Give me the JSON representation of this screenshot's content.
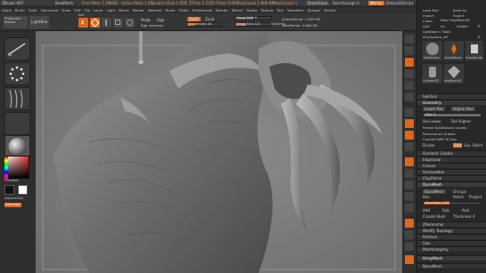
{
  "titlebar": {
    "app": "ZBrush 4R7",
    "items": [
      "ZBrush 4R7",
      "NewMesh",
      "Free Mem 7.398GB",
      "Active Mem 1.05",
      "Scratch Disk 1.059",
      "ZTime 1.2355",
      "Timer 0.005",
      "PolyCount 1.609 KP",
      "MeshCount 1"
    ],
    "right_items": [
      "QuickSave",
      "See-through 0",
      "Menus",
      "DefaultZScript"
    ]
  },
  "menubar": {
    "items": [
      "Alpha",
      "Brush",
      "Color",
      "Document",
      "Draw",
      "Edit",
      "File",
      "Layer",
      "Light",
      "Macro",
      "Marker",
      "Material",
      "Movie",
      "Picker",
      "Preferences",
      "Render",
      "Stencil",
      "Stroke",
      "Texture",
      "Tool",
      "Transform",
      "Zplugin",
      "Zscript"
    ]
  },
  "toolbar": {
    "left_button": "Projection Master",
    "left_button2": "LightBox",
    "edit": "Edit",
    "draw": "Draw",
    "move": "Move",
    "scale": "Scale",
    "rotate": "Rotate",
    "mrgb": "Mrgb",
    "rgb": "Rgb",
    "m": "M",
    "zadd": "Zadd",
    "zsub": "Zsub",
    "zcut": "Zcut",
    "rgb_intensity_label": "Rgb Intensity",
    "z_intensity_label": "Z Intensity 18",
    "focal_shift": "Focal Shift 0",
    "draw_size": "Draw Size 122",
    "active_points": "ActivePoints: 1.609 Mil",
    "total_points": "TotalPoints: 1.609 Mil",
    "dynamic": "Dynamic"
  },
  "status": {
    "coords": "1.058,0.55,-0.53"
  },
  "leftshelf": {
    "color_label": "Gradient",
    "switch_color": "SwitchColor",
    "alternate": "Alternate"
  },
  "tray": {
    "load_tool": "Load Tool",
    "save_as": "Save As",
    "import": "Import",
    "export": "Export",
    "clone": "Clone",
    "make_polymesh": "Make PolyMesh3D",
    "goz": "GoZ",
    "all": "All",
    "visible": "Visible",
    "r": "R",
    "lightbox_tools": "Lightbox > Tools",
    "polysphere_label": "PolySphere_48",
    "r2": "R",
    "tool_names": [
      "PolySphere",
      "SimpleBrush",
      "EraserBrush",
      "Cylinder3D",
      "PolyMesh3D"
    ],
    "subtool": "SubTool",
    "geometry": "Geometry",
    "lower_res": "Lower Res",
    "higher_res": "Higher Res",
    "sdiv": "SDiv 5",
    "del_lower": "Del Lower",
    "del_higher": "Del Higher",
    "freeze_subdiv": "Freeze SubDivision Levels",
    "reconstruct_subdiv": "Reconstruct Subdiv",
    "convert_bpr": "Convert BPR To Geo",
    "divide": "Divide",
    "smt": "Smt",
    "suv": "Suv",
    "reuv": "ReUV",
    "dynamic_subdiv": "Dynamic Subdiv",
    "edgeloop": "EdgeLoop",
    "crease": "Crease",
    "shadowbox": "ShadowBox",
    "claypolish": "ClayPolish",
    "dynamesh": "DynaMesh",
    "dynamesh_btn": "DynaMesh",
    "groups": "Groups",
    "polish": "Polish",
    "blur": "Blur",
    "project": "Project",
    "resolution": "Resolution 200",
    "add": "Add",
    "sub": "Sub",
    "and": "And",
    "create_shell": "Create Shell",
    "thickness": "Thickness 4",
    "zremesher": "ZRemesher",
    "modify_topology": "Modify Topology",
    "position": "Position",
    "size": "Size",
    "meshintegrity": "MeshIntegrity",
    "arraymesh": "ArrayMesh",
    "nanomesh": "NanoMesh"
  },
  "colors": {
    "accent": "#e0671a",
    "panel": "#2b2b2b",
    "viewport": "#7d7d7d"
  }
}
